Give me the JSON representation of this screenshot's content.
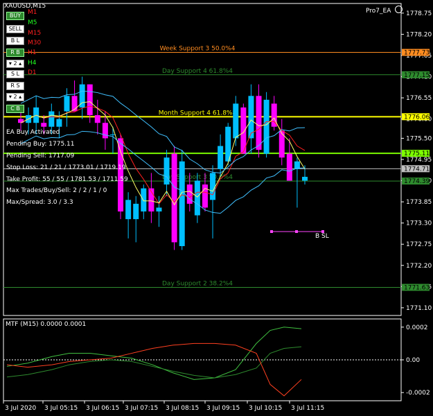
{
  "header": {
    "symbol": "XAUUSD,M15",
    "ea_name": "Pro7_EA",
    "ea_icon": "smiley-icon"
  },
  "buttons": [
    {
      "label": "BUY",
      "style": "green"
    },
    {
      "label": "SELL",
      "style": "white"
    },
    {
      "label": "B L",
      "style": "white"
    },
    {
      "label": "R B",
      "style": "green"
    },
    {
      "label": "▾ 2 ▴",
      "style": "white"
    },
    {
      "label": "S L",
      "style": "white"
    },
    {
      "label": "R S",
      "style": "white"
    },
    {
      "label": "▾ 2 ▴",
      "style": "white"
    },
    {
      "label": "C B",
      "style": "green"
    }
  ],
  "timeframes": [
    {
      "label": "M1",
      "color": "#ff2020"
    },
    {
      "label": "M5",
      "color": "#20ff20"
    },
    {
      "label": "M15",
      "color": "#ff2020"
    },
    {
      "label": "M30",
      "color": "#ff2020"
    },
    {
      "label": "H1",
      "color": "#ff2020"
    },
    {
      "label": "H4",
      "color": "#20ff20"
    },
    {
      "label": "D1",
      "color": "#ff2020"
    }
  ],
  "info_lines": [
    "EA Buy Activated",
    "Pending Buy: 1775.11",
    "Pending Sell: 1717.09",
    "Stop Loss: 21 / 21 / 1773.01 / 1719.19",
    "Take Profit: 55 / 55 / 1781.53 / 1711.59",
    "Max Trades/Buy/Sell: 2 / 2 / 1 / 0",
    "Max/Spread: 3.0 / 3.3"
  ],
  "levels": [
    {
      "label": "Week Support 3 50.0%4",
      "price": 1777.73,
      "color": "#ff8c20",
      "tag": "1777.73"
    },
    {
      "label": "Day Support 4 61.8%4",
      "price": 1777.15,
      "color": "#2e8b2e",
      "tag": "1777.15"
    },
    {
      "label": "Month Support 4 61.8%8",
      "price": 1776.06,
      "color": "#ffff00",
      "tag": "1776.06"
    },
    {
      "label": "",
      "price": 1775.11,
      "color": "#7cfc00",
      "tag": "1775.11"
    },
    {
      "label": "",
      "price": 1774.71,
      "color": "#c0c0c0",
      "tag": "1774.71"
    },
    {
      "label": "Day Support 3 50.0%4",
      "price": 1774.39,
      "color": "#2e8b2e",
      "tag": "1774.39"
    },
    {
      "label": "Day Support 2 38.2%4",
      "price": 1771.63,
      "color": "#2e8b2e",
      "tag": "1771.63"
    }
  ],
  "bsl_label": "B SL",
  "indicator": {
    "label": "MTF (M15) 0.0000 0.0001",
    "scale": [
      "0.0002",
      "0.00",
      "-0.0002"
    ]
  },
  "price_axis": [
    "1778.75",
    "1778.20",
    "1777.65",
    "1777.10",
    "1776.55",
    "1776.00",
    "1775.50",
    "1774.95",
    "1774.40",
    "1773.85",
    "1773.30",
    "1772.75",
    "1772.20",
    "1771.65",
    "1771.10"
  ],
  "time_axis": [
    "3 Jul 2020",
    "3 Jul 05:15",
    "3 Jul 06:15",
    "3 Jul 07:15",
    "3 Jul 08:15",
    "3 Jul 09:15",
    "3 Jul 10:15",
    "3 Jul 11:15"
  ],
  "colors": {
    "bull": "#00bfff",
    "bear": "#ff00ff",
    "bg": "#000000",
    "axis": "#ffffff"
  },
  "chart_data": {
    "type": "candlestick",
    "title": "XAUUSD,M15",
    "ylim": [
      1770.9,
      1779.0
    ],
    "candles": [
      {
        "o": 1776.0,
        "h": 1776.2,
        "l": 1775.7,
        "c": 1775.9
      },
      {
        "o": 1775.9,
        "h": 1776.3,
        "l": 1775.6,
        "c": 1776.1
      },
      {
        "o": 1775.9,
        "h": 1776.6,
        "l": 1775.6,
        "c": 1776.3
      },
      {
        "o": 1775.9,
        "h": 1776.1,
        "l": 1775.6,
        "c": 1775.8
      },
      {
        "o": 1775.8,
        "h": 1776.4,
        "l": 1775.6,
        "c": 1776.2
      },
      {
        "o": 1775.8,
        "h": 1776.2,
        "l": 1775.5,
        "c": 1776.0
      },
      {
        "o": 1776.2,
        "h": 1776.8,
        "l": 1775.8,
        "c": 1776.6
      },
      {
        "o": 1776.6,
        "h": 1777.0,
        "l": 1776.3,
        "c": 1776.2
      },
      {
        "o": 1776.3,
        "h": 1777.1,
        "l": 1776.0,
        "c": 1776.9
      },
      {
        "o": 1776.9,
        "h": 1776.9,
        "l": 1775.9,
        "c": 1776.1
      },
      {
        "o": 1776.1,
        "h": 1776.5,
        "l": 1775.6,
        "c": 1775.9
      },
      {
        "o": 1775.9,
        "h": 1776.2,
        "l": 1775.2,
        "c": 1775.5
      },
      {
        "o": 1775.6,
        "h": 1775.8,
        "l": 1775.1,
        "c": 1775.6
      },
      {
        "o": 1775.5,
        "h": 1775.6,
        "l": 1773.4,
        "c": 1773.6
      },
      {
        "o": 1773.4,
        "h": 1774.1,
        "l": 1772.9,
        "c": 1773.9
      },
      {
        "o": 1773.4,
        "h": 1774.0,
        "l": 1772.8,
        "c": 1773.8
      },
      {
        "o": 1773.6,
        "h": 1774.3,
        "l": 1773.4,
        "c": 1774.2
      },
      {
        "o": 1774.2,
        "h": 1774.6,
        "l": 1773.3,
        "c": 1773.6
      },
      {
        "o": 1773.6,
        "h": 1774.0,
        "l": 1773.2,
        "c": 1773.7
      },
      {
        "o": 1774.3,
        "h": 1775.2,
        "l": 1774.0,
        "c": 1775.0
      },
      {
        "o": 1775.1,
        "h": 1775.3,
        "l": 1772.6,
        "c": 1772.8
      },
      {
        "o": 1772.7,
        "h": 1775.2,
        "l": 1772.6,
        "c": 1774.9
      },
      {
        "o": 1774.3,
        "h": 1774.6,
        "l": 1773.6,
        "c": 1773.8
      },
      {
        "o": 1773.5,
        "h": 1774.6,
        "l": 1773.3,
        "c": 1774.4
      },
      {
        "o": 1774.3,
        "h": 1774.6,
        "l": 1773.6,
        "c": 1773.7
      },
      {
        "o": 1773.9,
        "h": 1774.8,
        "l": 1772.9,
        "c": 1774.6
      },
      {
        "o": 1774.7,
        "h": 1775.6,
        "l": 1774.5,
        "c": 1775.3
      },
      {
        "o": 1774.9,
        "h": 1775.9,
        "l": 1774.8,
        "c": 1775.8
      },
      {
        "o": 1775.5,
        "h": 1776.6,
        "l": 1775.3,
        "c": 1776.4
      },
      {
        "o": 1776.3,
        "h": 1776.4,
        "l": 1775.1,
        "c": 1775.1
      },
      {
        "o": 1775.5,
        "h": 1776.9,
        "l": 1775.1,
        "c": 1776.6
      },
      {
        "o": 1776.6,
        "h": 1776.9,
        "l": 1775.0,
        "c": 1775.2
      },
      {
        "o": 1775.1,
        "h": 1776.7,
        "l": 1775.0,
        "c": 1776.5
      },
      {
        "o": 1776.4,
        "h": 1776.6,
        "l": 1775.7,
        "c": 1775.8
      },
      {
        "o": 1775.7,
        "h": 1776.0,
        "l": 1774.8,
        "c": 1775.0
      },
      {
        "o": 1775.1,
        "h": 1775.5,
        "l": 1774.7,
        "c": 1774.4
      },
      {
        "o": 1774.7,
        "h": 1775.0,
        "l": 1773.7,
        "c": 1774.9
      },
      {
        "o": 1774.4,
        "h": 1774.8,
        "l": 1774.3,
        "c": 1774.5
      }
    ]
  }
}
